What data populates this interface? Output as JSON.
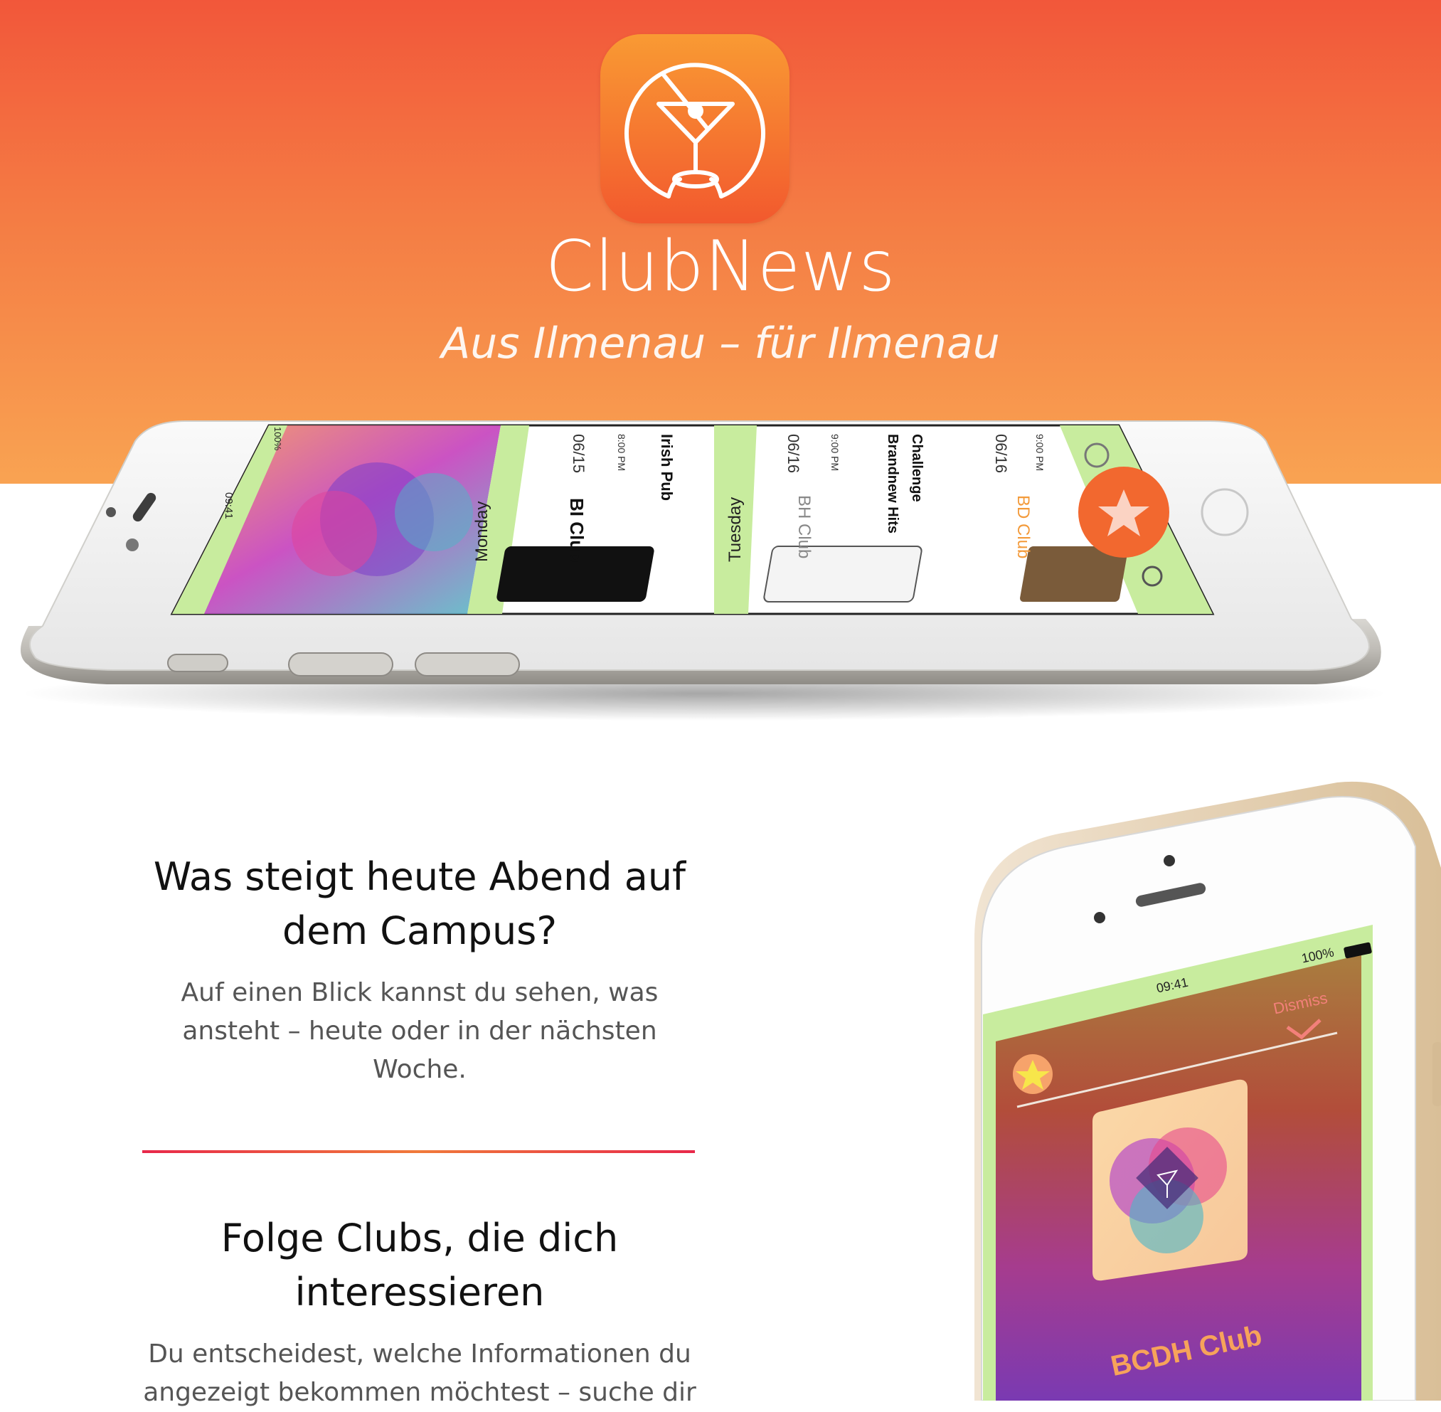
{
  "app": {
    "name": "ClubNews",
    "tagline": "Aus Ilmenau – für Ilmenau"
  },
  "colors": {
    "hero_top": "#f2573a",
    "hero_bottom": "#f9a352",
    "divider": "#e8284a",
    "app_green": "#c8ec9e",
    "accent_orange": "#f2682f"
  },
  "landscape_phone": {
    "time": "09:41",
    "battery": "100%",
    "cells": [
      {
        "day": "Monday",
        "date": "06/15",
        "time": "8:00 PM",
        "club": "BI Club",
        "event": "Irish Pub"
      },
      {
        "day": "Tuesday",
        "date": "06/16",
        "time": "9:00 PM",
        "club": "BH Club",
        "event_line1": "Brandnew Hits",
        "event_line2": "Challenge"
      },
      {
        "date": "06/16",
        "time": "9:00 PM",
        "club": "BD Club"
      }
    ],
    "icons": [
      "gear-icon",
      "star-icon",
      "location-pin-icon"
    ]
  },
  "features": [
    {
      "title_line1": "Was steigt heute Abend auf",
      "title_line2": "dem Campus?",
      "text_line1": "Auf einen Blick kannst du sehen, was",
      "text_line2": "ansteht – heute oder in der nächsten",
      "text_line3": "Woche."
    },
    {
      "title_line1": "Folge Clubs, die dich",
      "title_line2": "interessieren",
      "text_line1": "Du entscheidest, welche Informationen du",
      "text_line2": "angezeigt bekommen möchtest – suche dir"
    }
  ],
  "portrait_phone": {
    "time": "09:41",
    "battery": "100%",
    "dismiss_label": "Dismiss",
    "club_name": "BCDH Club"
  }
}
